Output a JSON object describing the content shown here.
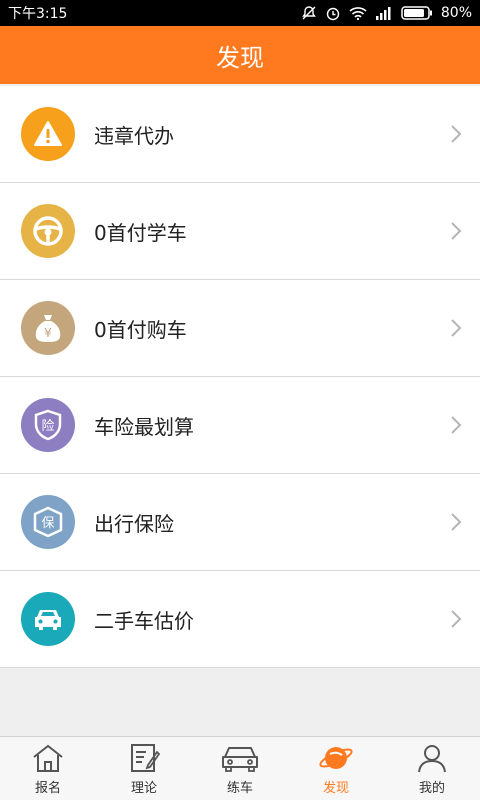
{
  "status": {
    "time": "下午3:15",
    "battery": "80%"
  },
  "header": {
    "title": "发现"
  },
  "items": [
    {
      "label": "违章代办",
      "icon": "warning-icon",
      "color": "#f7a01b"
    },
    {
      "label": "0首付学车",
      "icon": "steering-wheel-icon",
      "color": "#e6b446"
    },
    {
      "label": "0首付购车",
      "icon": "money-bag-icon",
      "color": "#c4a67d"
    },
    {
      "label": "车险最划算",
      "icon": "shield-insurance-icon",
      "color": "#8c7ec0"
    },
    {
      "label": "出行保险",
      "icon": "badge-bao-icon",
      "color": "#7ea3c7"
    },
    {
      "label": "二手车估价",
      "icon": "car-icon",
      "color": "#19a9b8"
    }
  ],
  "icon_text": {
    "shield": "险",
    "badge": "保",
    "currency": "¥"
  },
  "tabs": [
    {
      "label": "报名",
      "icon": "home-icon"
    },
    {
      "label": "理论",
      "icon": "notebook-icon"
    },
    {
      "label": "练车",
      "icon": "car-outline-icon"
    },
    {
      "label": "发现",
      "icon": "planet-icon",
      "active": true
    },
    {
      "label": "我的",
      "icon": "user-icon"
    }
  ],
  "colors": {
    "accent": "#ff7a1f"
  }
}
